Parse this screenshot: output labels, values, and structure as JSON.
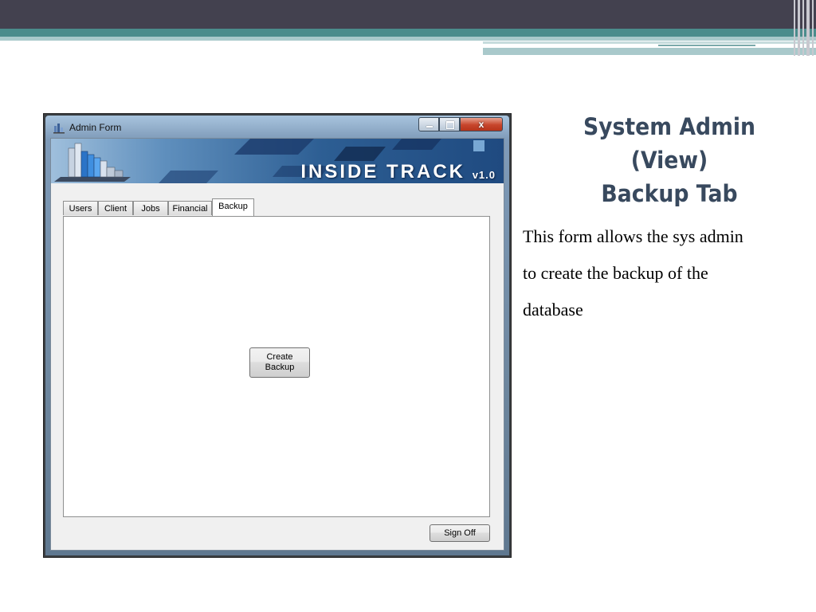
{
  "window": {
    "title": "Admin Form",
    "minimize_icon": "minimize-icon",
    "maximize_icon": "maximize-icon",
    "close_icon": "close-icon"
  },
  "banner": {
    "title": "INSIDE TRACK",
    "version": "v1.0",
    "logo_icon": "building-chart-icon"
  },
  "tabs": [
    {
      "label": "Users",
      "active": false
    },
    {
      "label": "Client",
      "active": false
    },
    {
      "label": "Jobs",
      "active": false
    },
    {
      "label": "Financial",
      "active": false
    },
    {
      "label": "Backup",
      "active": true
    }
  ],
  "backup_panel": {
    "create_backup_label": "Create\nBackup"
  },
  "footer": {
    "sign_off_label": "Sign Off"
  },
  "slide": {
    "title_lines": [
      "System Admin",
      "(View)",
      "Backup Tab"
    ],
    "body_lines": [
      "This form allows the sys admin",
      "to create the backup of the",
      "database"
    ]
  },
  "colors": {
    "header_dark": "#43414f",
    "header_teal": "#4b8c8c",
    "title_text": "#38495e"
  }
}
